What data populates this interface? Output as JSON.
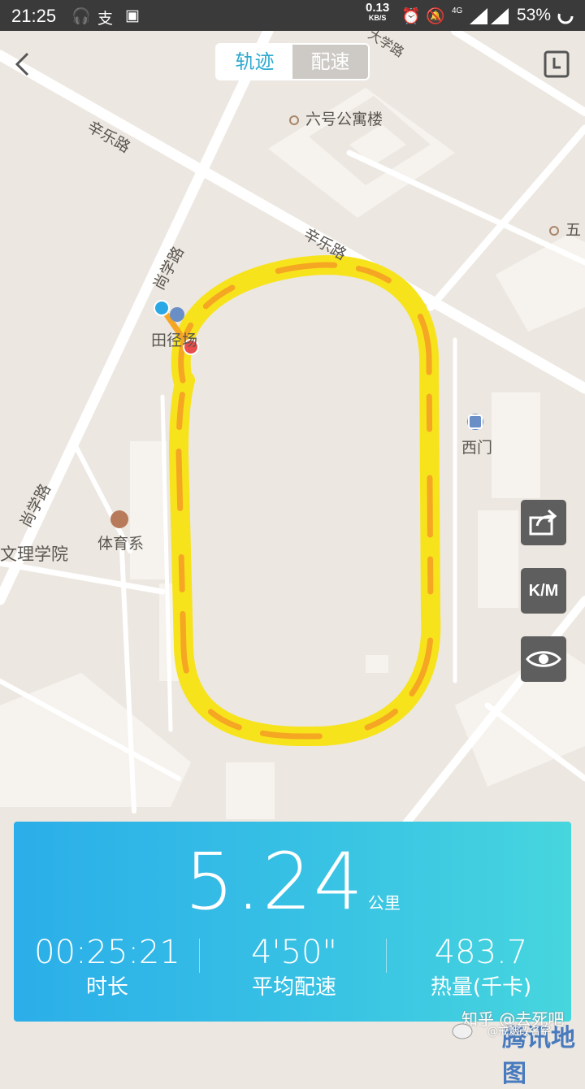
{
  "status_bar": {
    "time": "21:25",
    "net_speed": "0.13",
    "net_unit": "KB/S",
    "signal_label": "4G",
    "battery": "53%"
  },
  "header": {
    "tabs": [
      {
        "label": "轨迹",
        "active": true
      },
      {
        "label": "配速",
        "active": false
      }
    ]
  },
  "map": {
    "labels": {
      "road_xinle_1": "辛乐路",
      "road_xinle_2": "辛乐路",
      "road_shangxue_1": "尚学路",
      "road_shangxue_2": "尚学路",
      "poi_building6": "六号公寓楼",
      "poi_five": "五",
      "poi_tianjing": "田径场",
      "poi_ximen": "西门",
      "poi_tiyu": "体育系",
      "poi_wenli": "文理学院",
      "road_top_right": "大学路"
    },
    "brand": "腾讯地图"
  },
  "side_buttons": {
    "share_icon": "share-icon",
    "km_label": "K/M",
    "eye_icon": "eye-icon"
  },
  "stats": {
    "distance": "5.24",
    "distance_unit": "公里",
    "duration_value": "00:25:21",
    "duration_label": "时长",
    "pace_value": "4'50\"",
    "pace_label": "平均配速",
    "calories_value": "483.7",
    "calories_label": "热量(千卡)"
  },
  "watermark": {
    "line1": "知乎 @去死吧",
    "line2": "@戒烟改名字"
  },
  "colors": {
    "accent": "#2eaacf",
    "track_yellow": "#f7e31b",
    "track_orange": "#f5a623",
    "start_dot": "#2aa8e6",
    "end_dot": "#e84c4c"
  }
}
